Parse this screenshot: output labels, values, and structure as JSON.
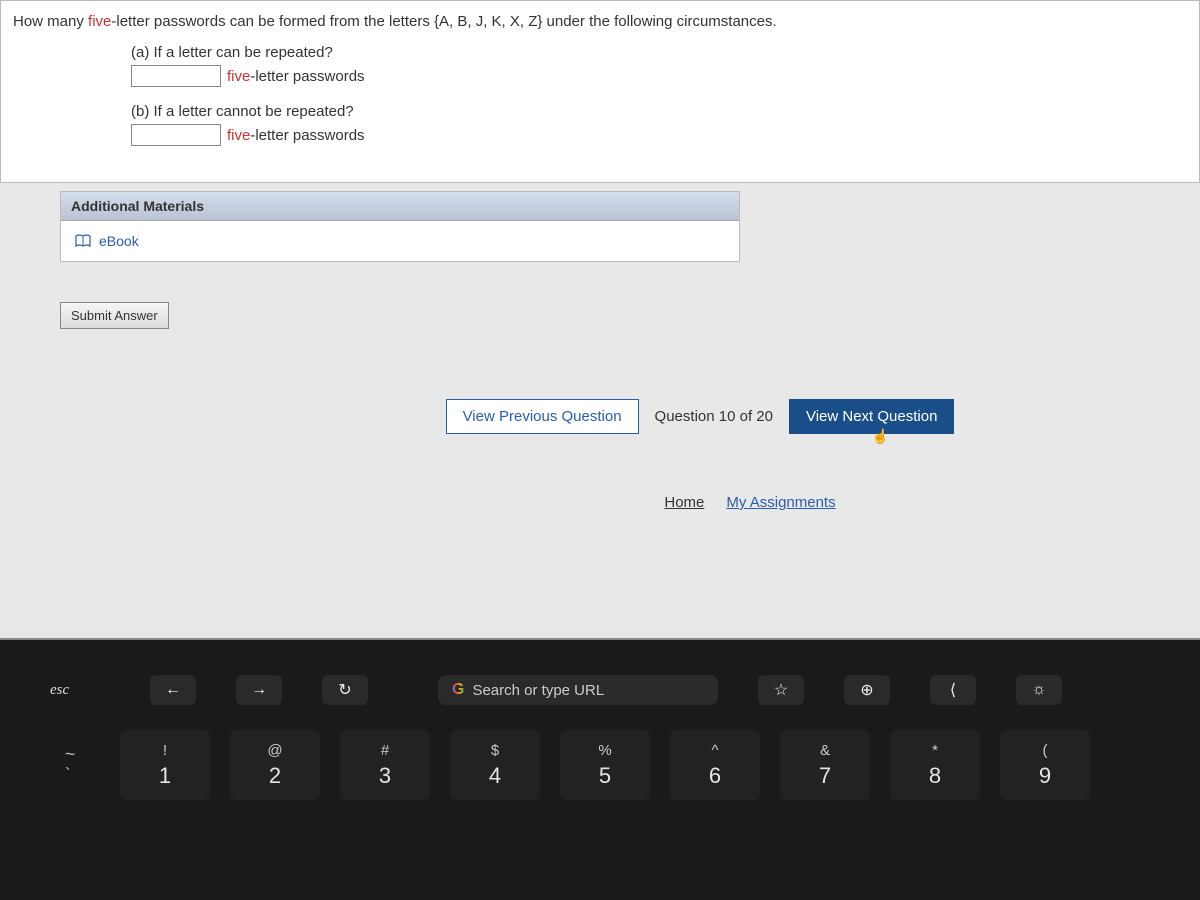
{
  "question": {
    "prefix": "How many ",
    "highlight1": "five",
    "mid1": "-letter passwords can be formed from the letters {A, B, J, K, X, Z} under the following circumstances.",
    "part_a_label": "(a) If a letter can be repeated?",
    "part_a_suffix_highlight": "five",
    "part_a_suffix_rest": "-letter passwords",
    "part_a_value": "",
    "part_b_label": "(b) If a letter cannot be repeated?",
    "part_b_suffix_highlight": "five",
    "part_b_suffix_rest": "-letter passwords",
    "part_b_value": ""
  },
  "additional": {
    "header": "Additional Materials",
    "ebook_label": "eBook"
  },
  "buttons": {
    "submit": "Submit Answer",
    "prev": "View Previous Question",
    "counter": "Question 10 of 20",
    "next": "View Next Question"
  },
  "footer": {
    "home": "Home",
    "assignments": "My Assignments"
  },
  "touchbar": {
    "esc": "esc",
    "search_placeholder": "Search or type URL"
  },
  "keys": [
    {
      "sym": "!",
      "num": "1"
    },
    {
      "sym": "@",
      "num": "2"
    },
    {
      "sym": "#",
      "num": "3"
    },
    {
      "sym": "$",
      "num": "4"
    },
    {
      "sym": "%",
      "num": "5"
    },
    {
      "sym": "^",
      "num": "6"
    },
    {
      "sym": "&",
      "num": "7"
    },
    {
      "sym": "*",
      "num": "8"
    },
    {
      "sym": "(",
      "num": "9"
    }
  ]
}
